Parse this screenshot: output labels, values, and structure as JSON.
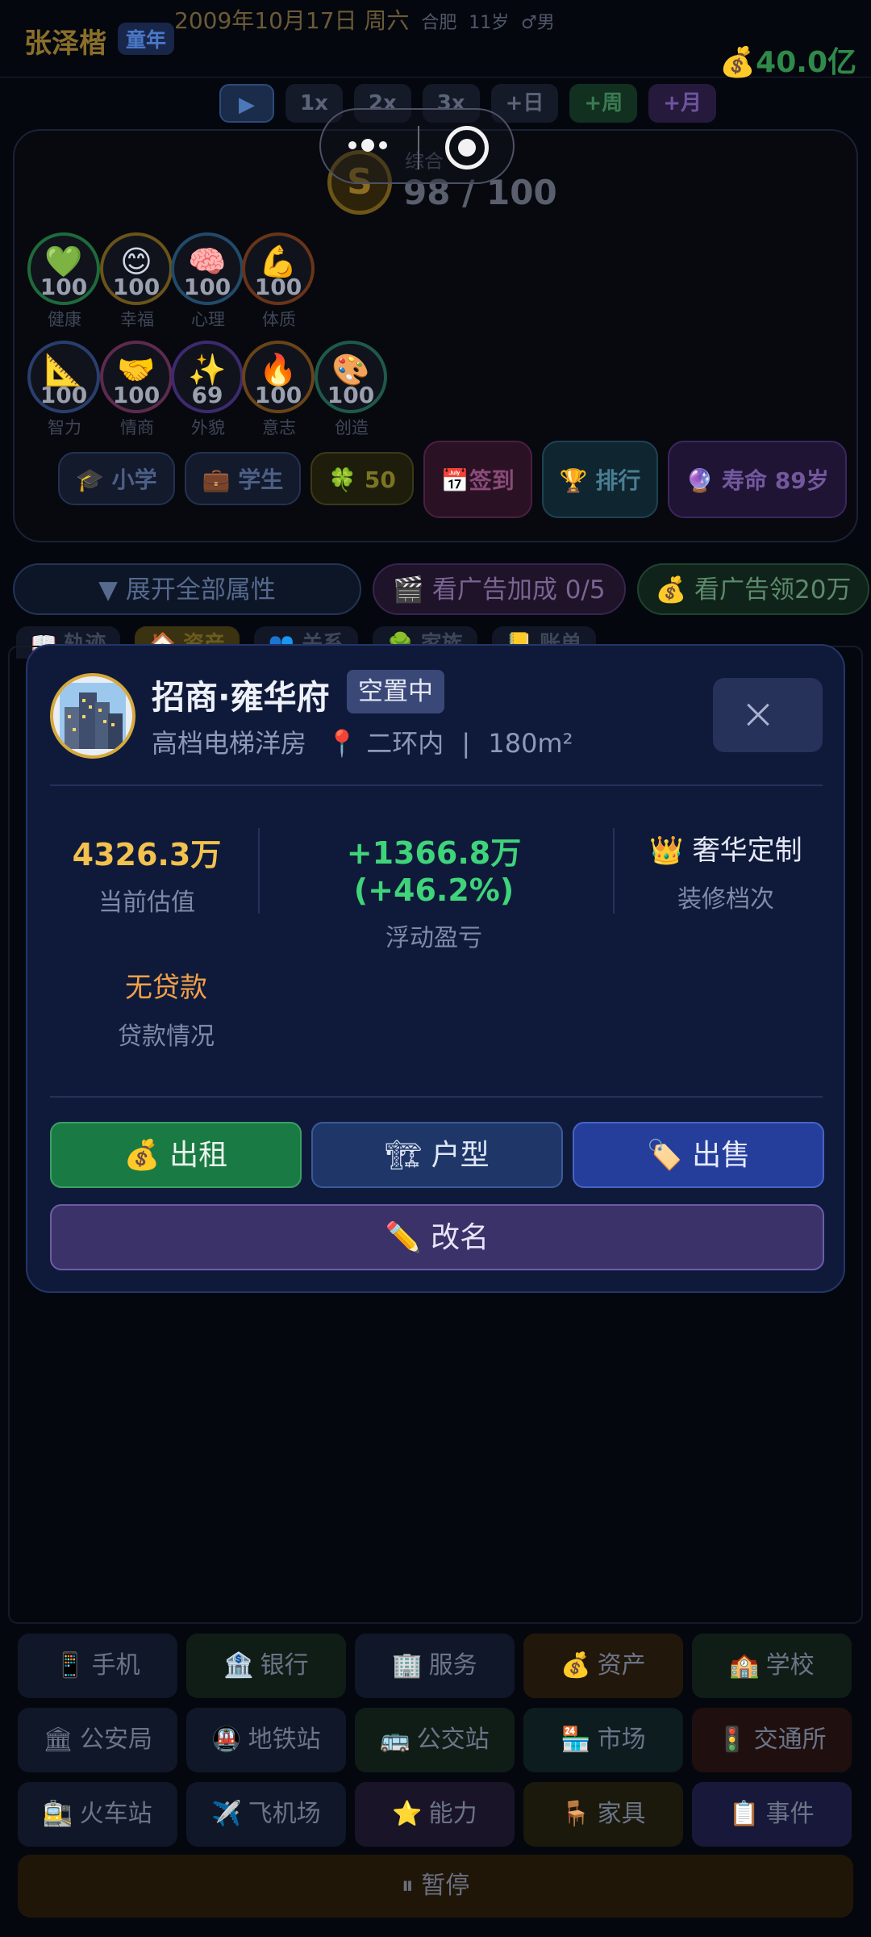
{
  "status_header": {
    "player_name": "张泽楷",
    "life_stage": "童年",
    "date": "2009年10月17日 周六",
    "city": "合肥",
    "age": "11岁",
    "gender": "♂男",
    "money": "💰40.0亿"
  },
  "speed_controls": {
    "play": "▶",
    "speeds": [
      "1x",
      "2x",
      "3x"
    ],
    "skips": [
      "+日",
      "+周",
      "+月"
    ]
  },
  "score": {
    "coin": "S",
    "label": "综合",
    "value": "98 / 100"
  },
  "attributes": [
    {
      "name": "健康",
      "value": "100",
      "glyph": "💚",
      "color": "#1f6a3a"
    },
    {
      "name": "幸福",
      "value": "100",
      "glyph": "😊",
      "color": "#6a5418"
    },
    {
      "name": "心理",
      "value": "100",
      "glyph": "🧠",
      "color": "#224a6a"
    },
    {
      "name": "体质",
      "value": "100",
      "glyph": "💪",
      "color": "#6a3418"
    },
    {
      "name": "智力",
      "value": "100",
      "glyph": "📐",
      "color": "#2a3e6e"
    },
    {
      "name": "情商",
      "value": "100",
      "glyph": "🤝",
      "color": "#5e2a4e"
    },
    {
      "name": "外貌",
      "value": "69",
      "glyph": "✨",
      "color": "#3e2a6e"
    },
    {
      "name": "意志",
      "value": "100",
      "glyph": "🔥",
      "color": "#6a4418"
    },
    {
      "name": "创造",
      "value": "100",
      "glyph": "🎨",
      "color": "#1e5a4a"
    }
  ],
  "tags": [
    {
      "icon": "🎓",
      "label": "小学"
    },
    {
      "icon": "💼",
      "label": "学生"
    },
    {
      "icon": "🍀",
      "label": "50"
    },
    {
      "icon": "📅",
      "label": "签到"
    },
    {
      "icon": "🏆",
      "label": "排行"
    },
    {
      "icon": "🔮",
      "label": "寿命 89岁"
    }
  ],
  "actions_row": {
    "expand": "▼ 展开全部属性",
    "ad_bonus": "🎬 看广告加成 0/5",
    "ad_money": "💰 看广告领20万"
  },
  "tabs": [
    "📖 轨迹",
    "🏠 资产",
    "👥 关系",
    "🌳 家族",
    "📒 账单"
  ],
  "bottom_menu": [
    {
      "icon": "📱",
      "label": "手机",
      "tone": "c-blue"
    },
    {
      "icon": "🏦",
      "label": "银行",
      "tone": "c-green"
    },
    {
      "icon": "🏢",
      "label": "服务",
      "tone": "c-blue"
    },
    {
      "icon": "💰",
      "label": "资产",
      "tone": "c-orange"
    },
    {
      "icon": "🏫",
      "label": "学校",
      "tone": "c-green"
    },
    {
      "icon": "🏛",
      "label": "公安局",
      "tone": "c-blue"
    },
    {
      "icon": "🚇",
      "label": "地铁站",
      "tone": "c-blue"
    },
    {
      "icon": "🚌",
      "label": "公交站",
      "tone": "c-green"
    },
    {
      "icon": "🏪",
      "label": "市场",
      "tone": "c-teal"
    },
    {
      "icon": "🚦",
      "label": "交通所",
      "tone": "c-red"
    },
    {
      "icon": "🚉",
      "label": "火车站",
      "tone": "c-blue"
    },
    {
      "icon": "✈️",
      "label": "飞机场",
      "tone": "c-blue"
    },
    {
      "icon": "⭐",
      "label": "能力",
      "tone": "c-purple"
    },
    {
      "icon": "🪑",
      "label": "家具",
      "tone": "c-olive"
    },
    {
      "icon": "📋",
      "label": "事件",
      "tone": "c-indigo"
    }
  ],
  "pause": "⏸ 暂停",
  "property_modal": {
    "icon": "city-building-icon",
    "name": "招商·雍华府",
    "status": "空置中",
    "type": "高档电梯洋房",
    "location": "📍 二环内",
    "separator": "|",
    "area": "180m²",
    "valuation_value": "4326.3万",
    "valuation_label": "当前估值",
    "pnl_value": "+1366.8万 (+46.2%)",
    "pnl_label": "浮动盈亏",
    "decor_value": "👑 奢华定制",
    "decor_label": "装修档次",
    "loan_value": "无贷款",
    "loan_label": "贷款情况",
    "btn_rent": "💰 出租",
    "btn_layout": "🏗 户型",
    "btn_sell": "🏷️ 出售",
    "btn_rename": "✏️ 改名",
    "colors": {
      "valuation": "#f2c14e",
      "pnl": "#3fd37a",
      "loan": "#f0a04a"
    }
  }
}
